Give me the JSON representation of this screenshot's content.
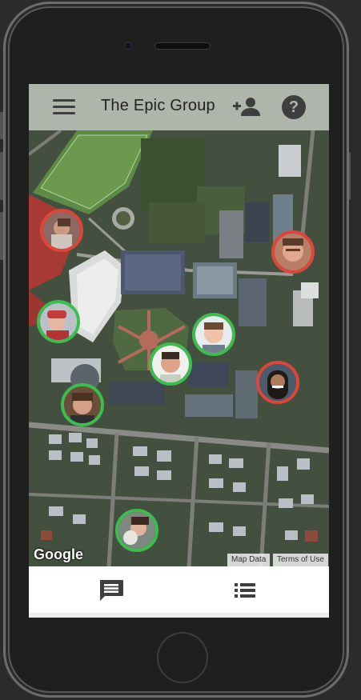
{
  "app": {
    "title": "The Epic Group"
  },
  "appbar": {
    "menu_icon": "hamburger-menu-icon",
    "add_member_icon": "person-add-icon",
    "help_icon": "help-circle-icon",
    "help_glyph": "?"
  },
  "map": {
    "provider_logo": "Google",
    "attribution_data": "Map Data",
    "attribution_terms": "Terms of Use",
    "members": [
      {
        "status": "offline",
        "color": "#e0453a"
      },
      {
        "status": "offline",
        "color": "#e0453a"
      },
      {
        "status": "online",
        "color": "#3cbd4e"
      },
      {
        "status": "online",
        "color": "#3cbd4e"
      },
      {
        "status": "online",
        "color": "#3cbd4e"
      },
      {
        "status": "offline",
        "color": "#e0453a"
      },
      {
        "status": "online",
        "color": "#3cbd4e"
      },
      {
        "status": "online",
        "color": "#3cbd4e"
      }
    ]
  },
  "bottom_nav": {
    "chat_icon": "chat-icon",
    "list_icon": "list-icon"
  }
}
